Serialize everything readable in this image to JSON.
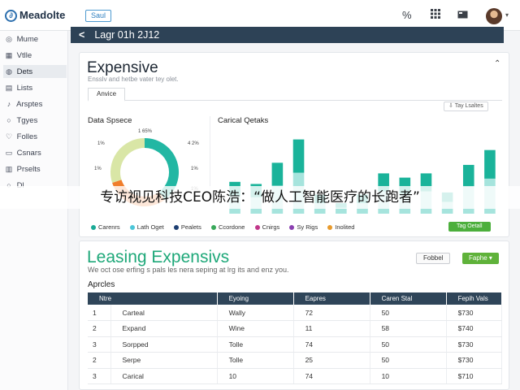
{
  "app": {
    "brand": "Meadolte",
    "badge": "Saul"
  },
  "topbar": {
    "percent_icon": "%",
    "grid_icon": "grid-icon",
    "window_icon": "window-icon"
  },
  "sidebar": {
    "items": [
      {
        "label": "Mume",
        "icon": "◎"
      },
      {
        "label": "Vtlle",
        "icon": "▦"
      },
      {
        "label": "Dets",
        "icon": "◍"
      },
      {
        "label": "Lists",
        "icon": "▤"
      },
      {
        "label": "Arsptes",
        "icon": "♪"
      },
      {
        "label": "Tgyes",
        "icon": "○"
      },
      {
        "label": "Folles",
        "icon": "♡"
      },
      {
        "label": "Csnars",
        "icon": "▭"
      },
      {
        "label": "Prselts",
        "icon": "▥"
      },
      {
        "label": "Dl",
        "icon": "○"
      }
    ]
  },
  "header": {
    "back": "<",
    "title": "Lagr 01h 2J12"
  },
  "card1": {
    "title": "Expensive",
    "subtitle": "Ensslv and hetbe vater tey olet.",
    "tab": "Anvice",
    "filter": "Tay Lsaltes",
    "left_section": "Data Spsece",
    "right_section": "Carical Qetaks",
    "legend": [
      {
        "label": "Carenrs",
        "color": "#1aaa96"
      },
      {
        "label": "Lath Oget",
        "color": "#4cc6d8"
      },
      {
        "label": "Pealets",
        "color": "#1d3f72"
      },
      {
        "label": "Ccordone",
        "color": "#39a85a"
      },
      {
        "label": "Cnirgs",
        "color": "#c1378a"
      },
      {
        "label": "Sy Rigs",
        "color": "#8a3fb0"
      },
      {
        "label": "Inolited",
        "color": "#e89a2c"
      }
    ],
    "action": "Tag Oetall"
  },
  "chart_data": [
    {
      "type": "pie",
      "title": "Data Spsece",
      "slice_labels": [
        "1 65%",
        "4 2%",
        "1%",
        "1%",
        "1%",
        "1%"
      ],
      "values": [
        40,
        30,
        30
      ],
      "colors": [
        "#22b7a3",
        "#f07d2c",
        "#d9e6a6"
      ]
    },
    {
      "type": "bar",
      "title": "Carical Qetaks",
      "series": [
        {
          "values": [
            30,
            28,
            48,
            70,
            18,
            10,
            18,
            38,
            34,
            38,
            20,
            46,
            60
          ]
        },
        {
          "values": [
            30,
            28,
            48,
            70,
            18,
            10,
            18,
            38,
            34,
            38,
            20,
            46,
            60
          ]
        }
      ],
      "colors": [
        "#1ab39a",
        "#a6e4dd"
      ]
    }
  ],
  "card2": {
    "title": "Leasing Expensivs",
    "subtitle": "We oct ose erfing s pals les nera seping at lrg its and enz you.",
    "btn_outline": "Fobbel",
    "btn_green": "Faphe",
    "section": "Aprcles",
    "columns": [
      "Ntre",
      "Eyoing",
      "Eapres",
      "Caren Stal",
      "Fepih Vals"
    ],
    "rows": [
      [
        "1",
        "Carteal",
        "Wally",
        "72",
        "50",
        "$730"
      ],
      [
        "2",
        "Expand",
        "Wine",
        "11",
        "58",
        "$740"
      ],
      [
        "3",
        "Sorpped",
        "Tolle",
        "74",
        "50",
        "$730"
      ],
      [
        "2",
        "Serpe",
        "Tolle",
        "25",
        "50",
        "$730"
      ],
      [
        "3",
        "Carical",
        "10",
        "74",
        "10",
        "$710"
      ]
    ]
  },
  "caption": "专访视见科技CEO陈浩：“做人工智能医疗的长跑者”"
}
